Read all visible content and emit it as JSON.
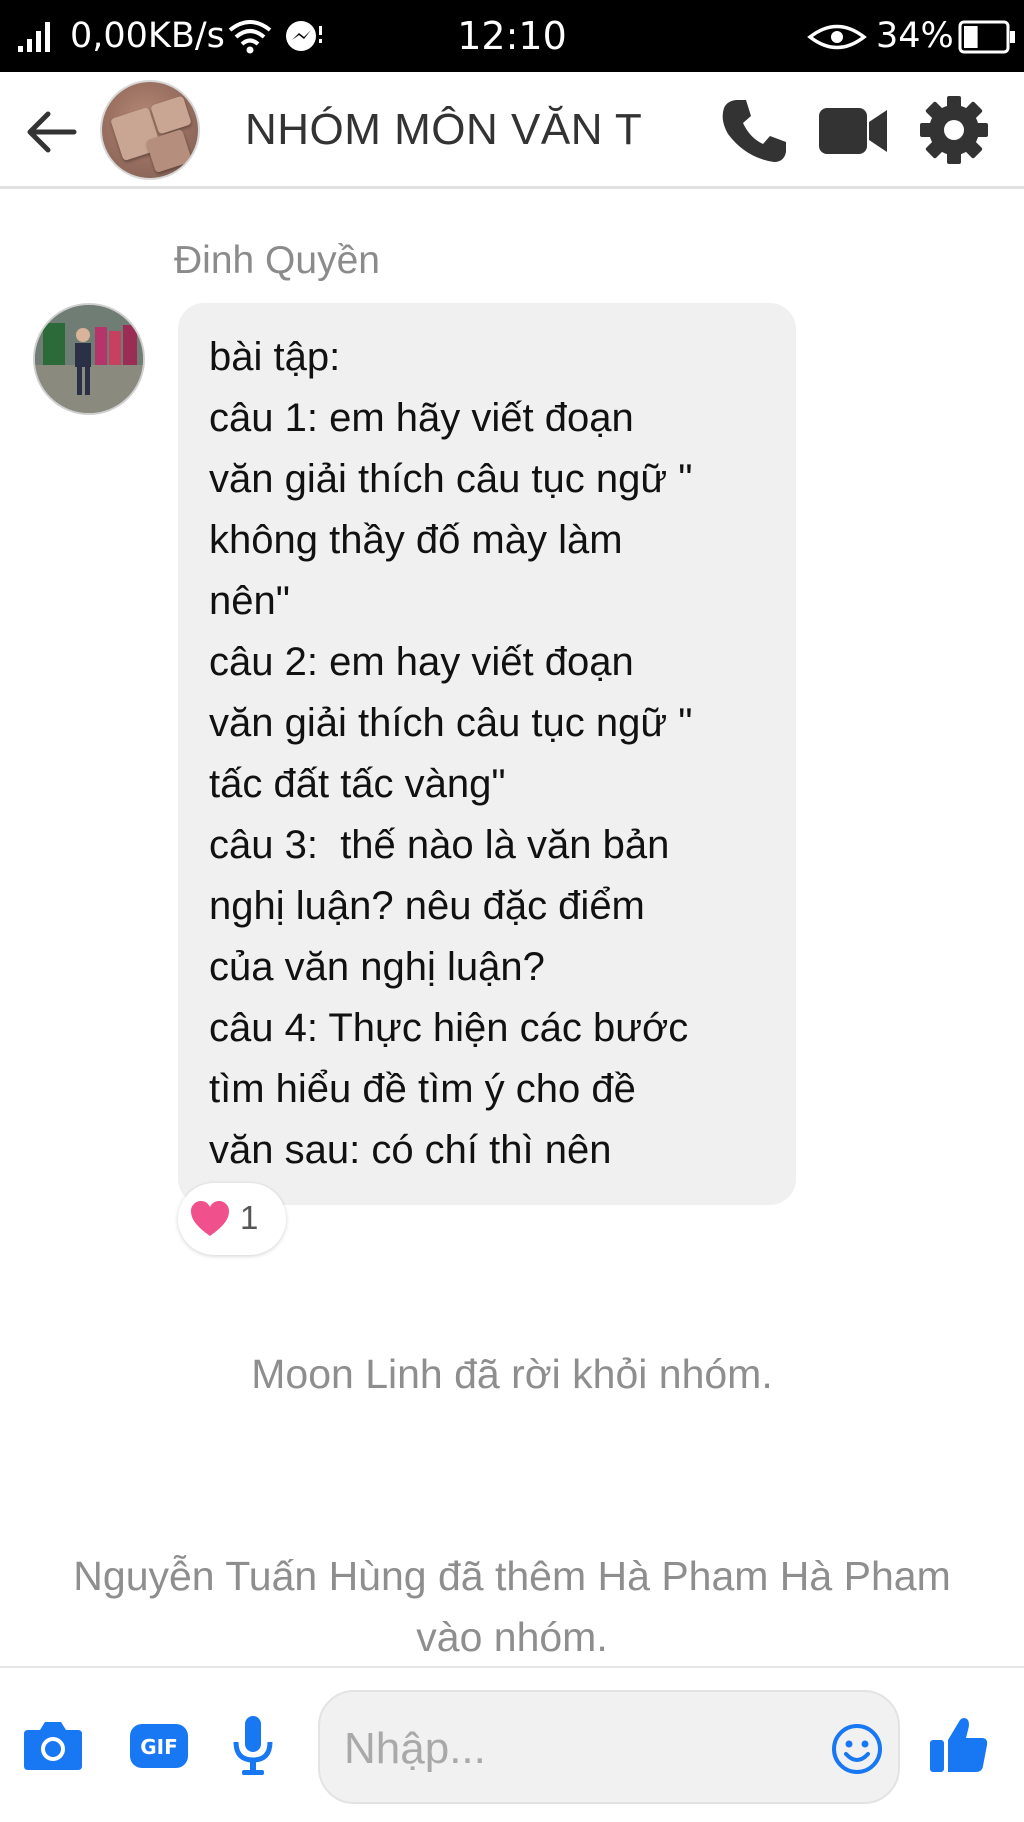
{
  "status_bar": {
    "network_speed": "0,00KB/s",
    "time": "12:10",
    "battery_percent": "34%",
    "battery_level": 0.34
  },
  "header": {
    "title": "NHÓM MÔN VĂN T",
    "icons": [
      "back-arrow-icon",
      "phone-icon",
      "video-camera-icon",
      "gear-icon"
    ]
  },
  "message": {
    "sender": "Đinh Quyền",
    "text": "bài tập:\ncâu 1: em hãy viết đoạn\nvăn giải thích câu tục ngữ \"\nkhông thầy đố mày làm\nnên\"\ncâu 2: em hay viết đoạn\nvăn giải thích câu tục ngữ \"\ntấc đất tấc vàng\"\ncâu 3:  thế nào là văn bản\nnghị luận? nêu đặc điểm\ncủa văn nghị luận?\ncâu 4: Thực hiện các bước\ntìm hiểu đề tìm ý cho đề\nvăn sau: có chí thì nên",
    "reaction": {
      "icon": "heart-icon",
      "count": "1"
    }
  },
  "system_messages": [
    "Moon Linh đã rời khỏi nhóm.",
    "Nguyễn Tuấn Hùng đã thêm Hà Pham Hà Pham\nvào nhóm."
  ],
  "composer": {
    "placeholder": "Nhập...",
    "icons": [
      "camera-icon",
      "gif-icon",
      "microphone-icon",
      "emoji-icon",
      "thumbs-up-icon"
    ]
  },
  "colors": {
    "accent": "#1877f2",
    "header_text": "#333333",
    "bubble_bg": "#f1f0f0",
    "system_text": "#8e8e8e",
    "heart": "#f0508c"
  }
}
